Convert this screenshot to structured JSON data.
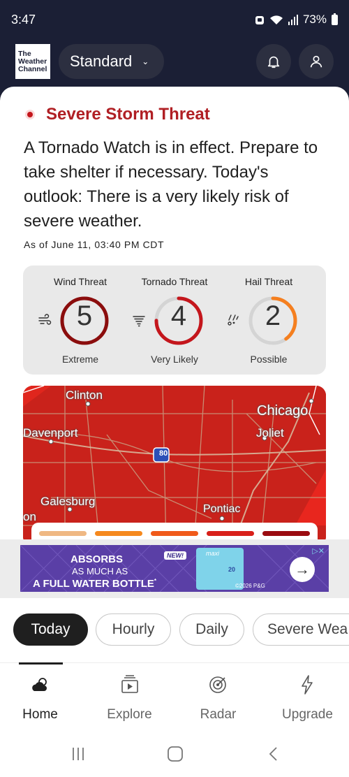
{
  "status_bar": {
    "time": "3:47",
    "battery": "73%"
  },
  "header": {
    "logo_line1": "The",
    "logo_line2": "Weather",
    "logo_line3": "Channel",
    "unit_selector": "Standard"
  },
  "alert": {
    "title": "Severe Storm Threat",
    "body": "A Tornado Watch is in effect. Prepare to take shelter if necessary. Today's outlook: There is a very likely risk of severe weather.",
    "as_of": "As of June 11, 03:40 PM CDT"
  },
  "threats": [
    {
      "label": "Wind Threat",
      "value": "5",
      "level": "Extreme",
      "fraction": 1.0,
      "color": "#8b0d0d",
      "icon": "wind-icon"
    },
    {
      "label": "Tornado Threat",
      "value": "4",
      "level": "Very Likely",
      "fraction": 0.75,
      "color": "#c4161c",
      "icon": "tornado-icon"
    },
    {
      "label": "Hail Threat",
      "value": "2",
      "level": "Possible",
      "fraction": 0.4,
      "color": "#f57f1f",
      "icon": "hail-icon"
    }
  ],
  "map": {
    "cities": [
      "Clinton",
      "Chicago",
      "Davenport",
      "Joliet",
      "Galesburg",
      "Pontiac",
      "on"
    ],
    "highway": "80",
    "legend_colors": [
      "#efb883",
      "#f5891e",
      "#f05a1a",
      "#d8201a",
      "#9a0b10"
    ]
  },
  "ad": {
    "line1": "ABSORBS",
    "line2": "AS MUCH AS",
    "line3": "A FULL WATER BOTTLE",
    "tm": "*",
    "badge": "NEW!",
    "brand": "maxi",
    "size": "20",
    "copyright": "©2026 P&G"
  },
  "tabs": [
    {
      "label": "Today",
      "active": true
    },
    {
      "label": "Hourly",
      "active": false
    },
    {
      "label": "Daily",
      "active": false
    },
    {
      "label": "Severe Wea",
      "active": false
    }
  ],
  "bottom_nav": [
    {
      "label": "Home",
      "icon": "home-cloud-icon",
      "active": true
    },
    {
      "label": "Explore",
      "icon": "video-play-icon",
      "active": false
    },
    {
      "label": "Radar",
      "icon": "radar-icon",
      "active": false
    },
    {
      "label": "Upgrade",
      "icon": "lightning-icon",
      "active": false
    }
  ]
}
